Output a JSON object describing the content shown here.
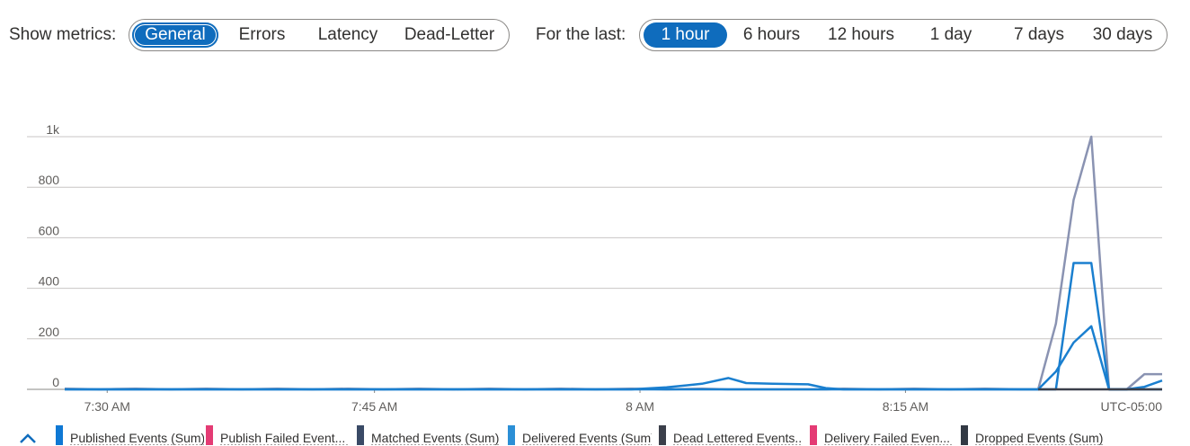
{
  "toolbar": {
    "metrics_label": "Show metrics:",
    "metrics_options": [
      "General",
      "Errors",
      "Latency",
      "Dead-Letter"
    ],
    "metrics_selected": "General",
    "range_label": "For the last:",
    "range_options": [
      "1 hour",
      "6 hours",
      "12 hours",
      "1 day",
      "7 days",
      "30 days"
    ],
    "range_selected": "1 hour"
  },
  "colors": {
    "accent": "#0f6cbd",
    "grid": "#c8c6c4",
    "published": "#0f78d4",
    "publish_failed": "#e43b74",
    "matched": "#3a4a66",
    "delivered": "#2b8fd6",
    "dead_lettered": "#3b3f4a",
    "delivery_failed": "#e43b74",
    "dropped": "#323944",
    "combined_line": "#8a93b2"
  },
  "chart_data": {
    "type": "line",
    "y_ticks": [
      "1k",
      "800",
      "600",
      "400",
      "200",
      "0"
    ],
    "ylim": [
      0,
      1000
    ],
    "x_ticks": [
      "7:30 AM",
      "7:45 AM",
      "8 AM",
      "8:15 AM",
      "UTC-05:00"
    ],
    "x_range_minutes": [
      0,
      62
    ],
    "x_tick_minutes": [
      2.4,
      17.5,
      32.5,
      47.5
    ],
    "grid": true,
    "series": [
      {
        "name": "Published Events (Sum)",
        "color": "#8a93b2",
        "x": [
          0,
          2,
          4,
          6,
          8,
          10,
          12,
          14,
          16,
          18,
          20,
          22,
          24,
          26,
          28,
          30,
          32,
          34,
          36,
          37.5,
          39,
          40,
          41,
          42,
          43,
          44,
          46,
          48,
          50,
          52,
          54,
          55,
          56,
          57,
          58,
          59,
          60,
          61,
          62
        ],
        "y": [
          3,
          0,
          3,
          0,
          3,
          0,
          3,
          0,
          3,
          0,
          3,
          0,
          3,
          0,
          3,
          0,
          3,
          0,
          3,
          0,
          0,
          0,
          0,
          0,
          0,
          3,
          0,
          3,
          0,
          3,
          0,
          0,
          260,
          750,
          1000,
          0,
          0,
          60,
          60
        ]
      },
      {
        "name": "Delivered Events (Sum)",
        "color": "#1a7fcf",
        "x": [
          0,
          32,
          34,
          36,
          37.5,
          38.5,
          40,
          42,
          43,
          44,
          46,
          48,
          50,
          52,
          54,
          55,
          56,
          57,
          58,
          59,
          60,
          61,
          62
        ],
        "y": [
          0,
          0,
          8,
          22,
          45,
          25,
          22,
          20,
          5,
          0,
          0,
          0,
          0,
          0,
          0,
          0,
          70,
          185,
          250,
          0,
          0,
          10,
          35
        ]
      },
      {
        "name": "Matched Events (Sum)",
        "color": "#1a7fcf",
        "x": [
          0,
          55,
          56,
          57,
          58,
          59,
          62
        ],
        "y": [
          0,
          0,
          0,
          500,
          500,
          0,
          0
        ]
      },
      {
        "name": "Dead Lettered Events (Sum)",
        "color": "#3b3f4a",
        "x": [
          55,
          62
        ],
        "y": [
          0,
          0
        ]
      }
    ]
  },
  "legend": {
    "items": [
      {
        "label": "Published Events (Sum)",
        "color": "#0f78d4"
      },
      {
        "label": "Publish Failed Event...",
        "color": "#e43b74"
      },
      {
        "label": "Matched Events (Sum)",
        "color": "#3a4a66"
      },
      {
        "label": "Delivered Events (Sum)",
        "color": "#2b8fd6"
      },
      {
        "label": "Dead Lettered Events...",
        "color": "#3b3f4a"
      },
      {
        "label": "Delivery Failed Even...",
        "color": "#e43b74"
      },
      {
        "label": "Dropped Events (Sum)",
        "color": "#323944"
      }
    ]
  }
}
